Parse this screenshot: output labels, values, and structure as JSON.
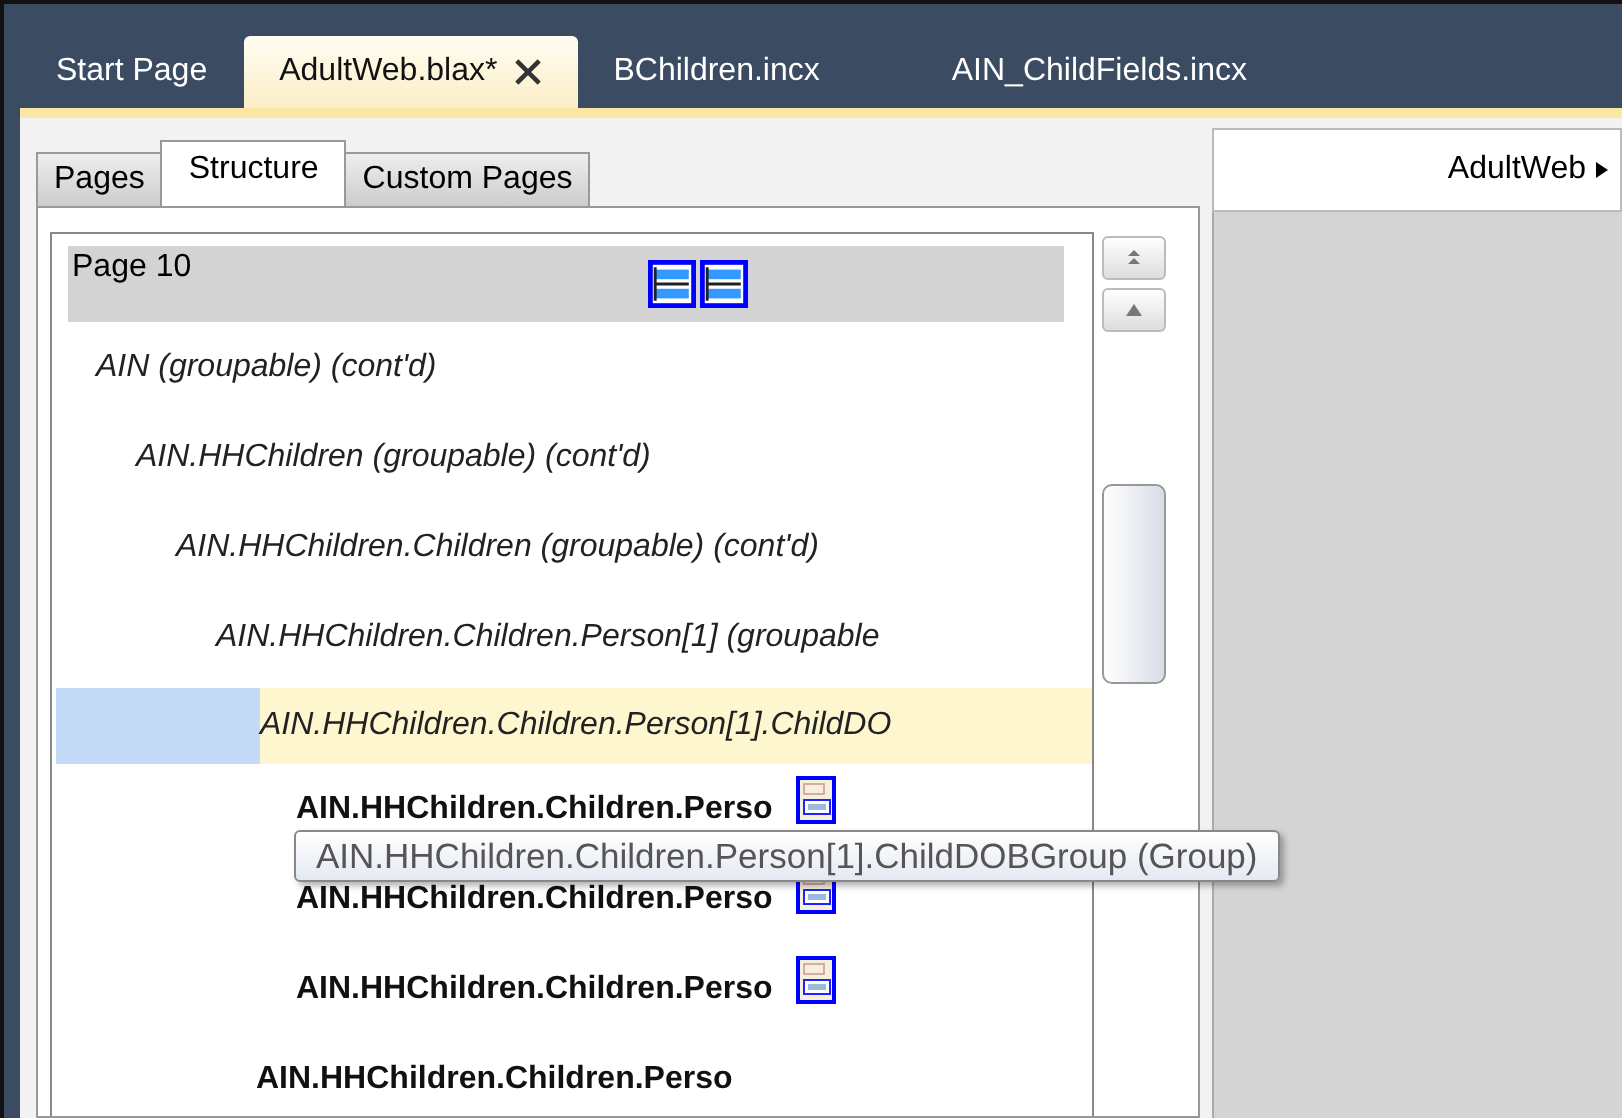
{
  "doc_tabs": [
    {
      "label": "Start Page",
      "selected": false,
      "closable": false
    },
    {
      "label": "AdultWeb.blax*",
      "selected": true,
      "closable": true
    },
    {
      "label": "BChildren.incx",
      "selected": false,
      "closable": false
    },
    {
      "label": "AIN_ChildFields.incx",
      "selected": false,
      "closable": false
    }
  ],
  "view_tabs": [
    {
      "label": "Pages",
      "selected": false
    },
    {
      "label": "Structure",
      "selected": true
    },
    {
      "label": "Custom Pages",
      "selected": false
    }
  ],
  "tree": {
    "page": {
      "label": "Page 10"
    },
    "items": [
      {
        "label": "AIN (groupable) (cont'd)",
        "kind": "group",
        "selected": false,
        "icon": false,
        "children": [
          {
            "label": "AIN.HHChildren (groupable) (cont'd)",
            "kind": "group",
            "selected": false,
            "icon": false,
            "children": [
              {
                "label": "AIN.HHChildren.Children (groupable) (cont'd)",
                "kind": "group",
                "selected": false,
                "icon": false,
                "children": [
                  {
                    "label": "AIN.HHChildren.Children.Person[1] (groupable",
                    "kind": "group",
                    "selected": false,
                    "icon": false,
                    "children": [
                      {
                        "label": "AIN.HHChildren.Children.Person[1].ChildDO",
                        "kind": "group",
                        "selected": true,
                        "icon": false,
                        "children": [
                          {
                            "label": "AIN.HHChildren.Children.Perso",
                            "kind": "field",
                            "selected": false,
                            "icon": true
                          },
                          {
                            "label": "AIN.HHChildren.Children.Perso",
                            "kind": "field",
                            "selected": false,
                            "icon": true
                          },
                          {
                            "label": "AIN.HHChildren.Children.Perso",
                            "kind": "field",
                            "selected": false,
                            "icon": true
                          }
                        ]
                      },
                      {
                        "label": "AIN.HHChildren.Children.Perso",
                        "kind": "field",
                        "selected": false,
                        "icon": false
                      }
                    ]
                  }
                ]
              }
            ]
          }
        ]
      }
    ]
  },
  "tooltip": "AIN.HHChildren.Children.Person[1].ChildDOBGroup (Group)",
  "breadcrumb": {
    "label": "AdultWeb"
  }
}
